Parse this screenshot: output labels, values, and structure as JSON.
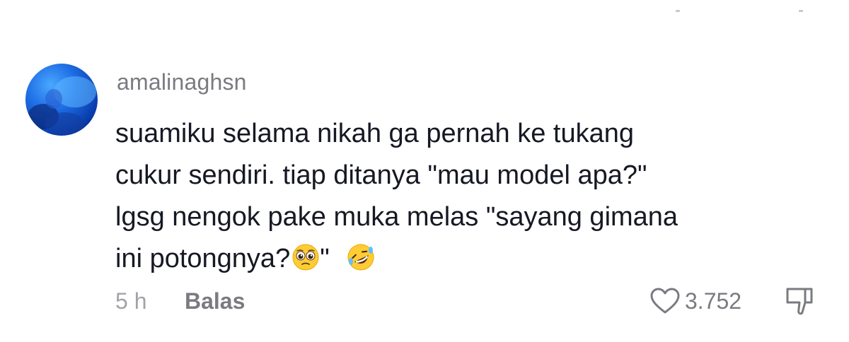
{
  "comment": {
    "username": "amalinaghsn",
    "lines": [
      "suamiku selama nikah ga pernah ke tukang",
      "cukur sendiri. tiap ditanya \"mau model apa?\"",
      "lgsg nengok pake muka melas \"sayang gimana",
      "ini potongnya?"
    ],
    "line4_after_emoji": "\" ",
    "emojis": [
      "pleading-face",
      "rolling-on-the-floor-laughing"
    ],
    "time": "5 h",
    "reply_label": "Balas",
    "like_count": "3.752"
  },
  "colors": {
    "text": "#161823",
    "secondary": "#7a7b80",
    "tertiary": "#a2a3a8",
    "emoji_yellow": "#ffcc33"
  },
  "icons": [
    "heart-outline-icon",
    "thumbs-down-icon"
  ]
}
